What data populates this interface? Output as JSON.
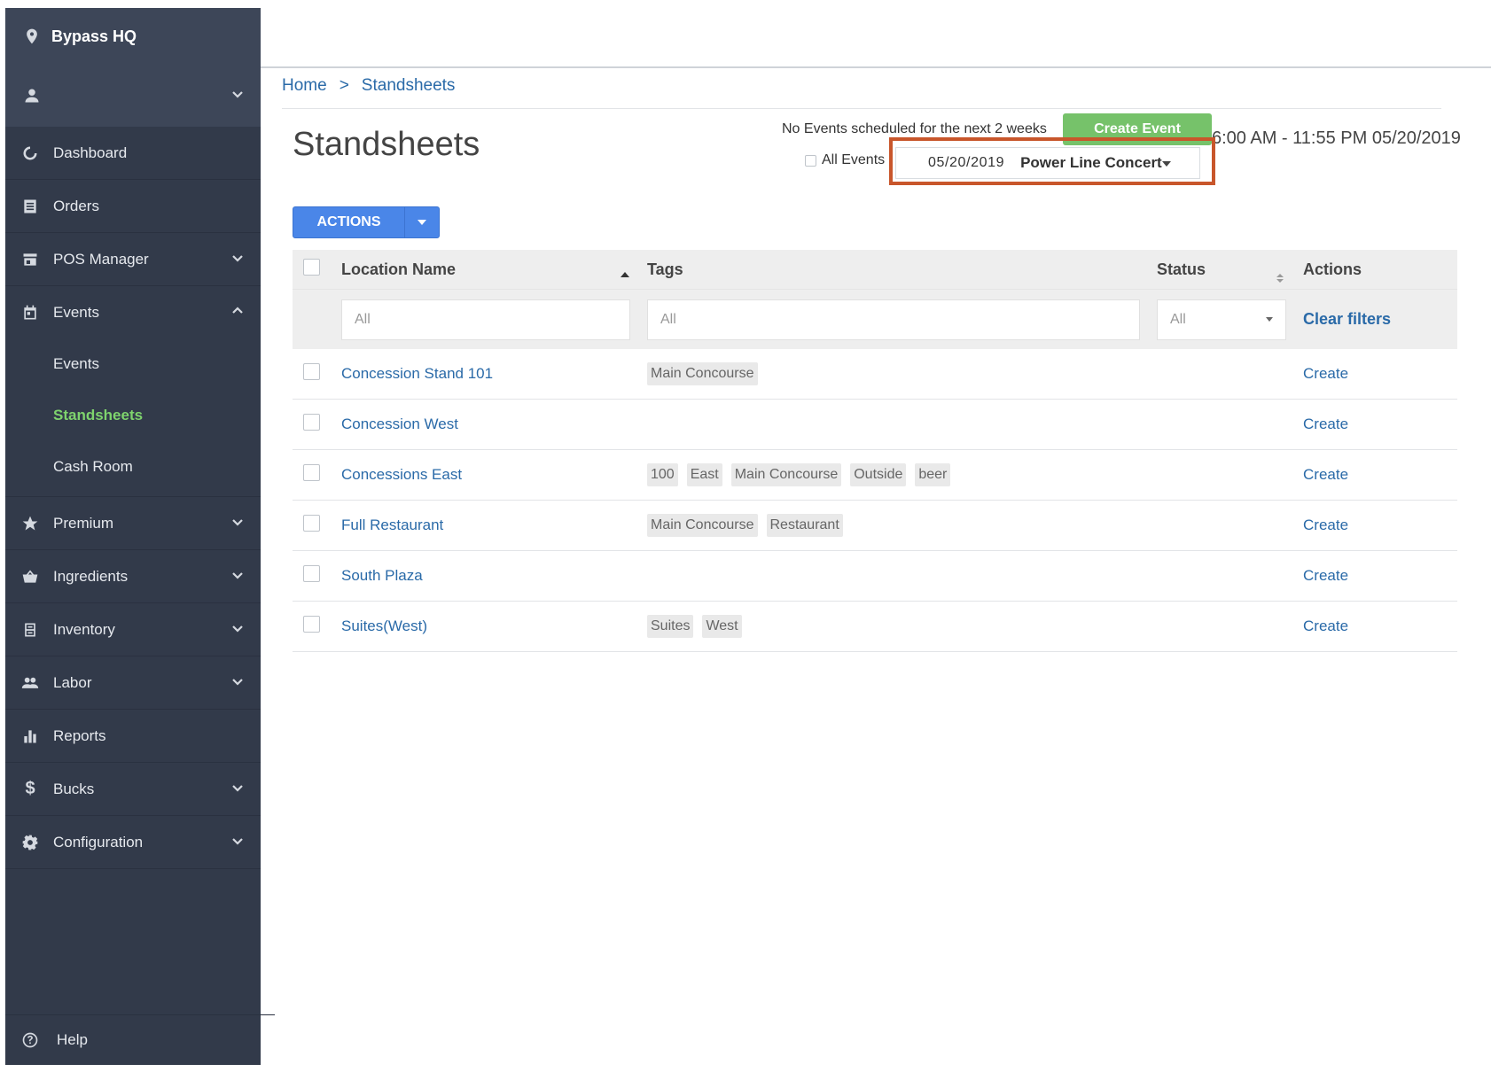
{
  "sidebar": {
    "brand": "Bypass HQ",
    "items": {
      "dashboard": "Dashboard",
      "orders": "Orders",
      "pos_manager": "POS Manager",
      "events": "Events",
      "premium": "Premium",
      "ingredients": "Ingredients",
      "inventory": "Inventory",
      "labor": "Labor",
      "reports": "Reports",
      "bucks": "Bucks",
      "configuration": "Configuration"
    },
    "events_sub": {
      "events": "Events",
      "standsheets": "Standsheets",
      "cash_room": "Cash Room"
    },
    "help": "Help",
    "active_color": "#7ed36d"
  },
  "breadcrumb": {
    "home": "Home",
    "separator": ">",
    "current": "Standsheets"
  },
  "header": {
    "title": "Standsheets",
    "no_events": "No Events scheduled for the next 2 weeks",
    "create_event": "Create Event",
    "time_range": "6:00 AM - 11:55 PM 05/20/2019",
    "all_events_label": "All Events",
    "selected_event": {
      "date": "05/20/2019",
      "name": "Power Line Concert"
    }
  },
  "toolbar": {
    "actions_label": "ACTIONS"
  },
  "table": {
    "columns": {
      "location_name": "Location Name",
      "tags": "Tags",
      "status": "Status",
      "actions": "Actions"
    },
    "filters": {
      "location_placeholder": "All",
      "tags_placeholder": "All",
      "status_value": "All",
      "clear_filters": "Clear filters"
    },
    "rows": [
      {
        "name": "Concession Stand 101",
        "tags": [
          "Main Concourse"
        ],
        "action": "Create"
      },
      {
        "name": "Concession West",
        "tags": [],
        "action": "Create"
      },
      {
        "name": "Concessions East",
        "tags": [
          "100",
          "East",
          "Main Concourse",
          "Outside",
          "beer"
        ],
        "action": "Create"
      },
      {
        "name": "Full Restaurant",
        "tags": [
          "Main Concourse",
          "Restaurant"
        ],
        "action": "Create"
      },
      {
        "name": "South Plaza",
        "tags": [],
        "action": "Create"
      },
      {
        "name": "Suites(West)",
        "tags": [
          "Suites",
          "West"
        ],
        "action": "Create"
      }
    ]
  },
  "colors": {
    "sidebar_bg": "#323a4a",
    "link": "#2a6aa8",
    "create_event_bg": "#76c26a",
    "actions_bg": "#4a86e8",
    "highlight": "#c8562b"
  }
}
